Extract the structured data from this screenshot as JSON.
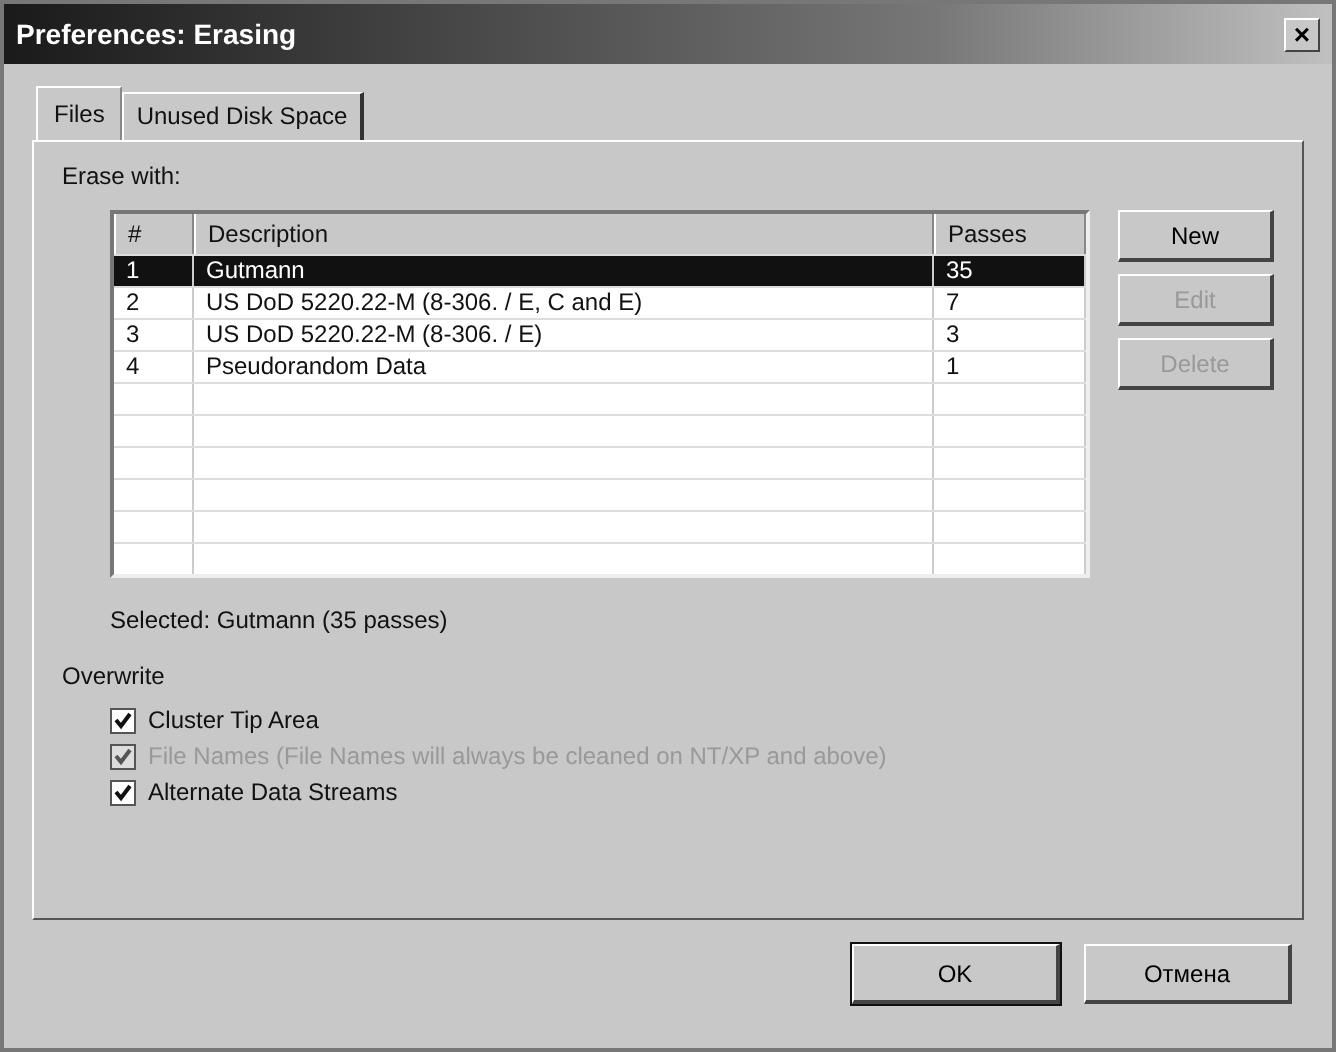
{
  "window": {
    "title": "Preferences: Erasing",
    "close": "×"
  },
  "tabs": [
    {
      "label": "Files",
      "selected": true
    },
    {
      "label": "Unused Disk Space",
      "selected": false
    }
  ],
  "erase_with": {
    "label": "Erase with:",
    "table": {
      "columns": [
        "#",
        "Description",
        "Passes"
      ],
      "rows": [
        {
          "cells": [
            "1",
            "Gutmann",
            "35"
          ],
          "selected": true
        },
        {
          "cells": [
            "2",
            "US DoD 5220.22-M (8-306. / E, C and E)",
            "7"
          ],
          "selected": false
        },
        {
          "cells": [
            "3",
            "US DoD 5220.22-M (8-306. / E)",
            "3"
          ],
          "selected": false
        },
        {
          "cells": [
            "4",
            "Pseudorandom Data",
            "1"
          ],
          "selected": false
        }
      ]
    },
    "buttons": [
      {
        "label": "New",
        "disabled": false
      },
      {
        "label": "Edit",
        "disabled": true
      },
      {
        "label": "Delete",
        "disabled": true
      }
    ],
    "selected_text": "Selected: Gutmann (35 passes)"
  },
  "overwrite": {
    "label": "Overwrite",
    "options": [
      {
        "label": "Cluster Tip Area",
        "checked": true,
        "disabled": false
      },
      {
        "label": "File Names (File Names will always be cleaned on NT/XP and above)",
        "checked": true,
        "disabled": true
      },
      {
        "label": "Alternate Data Streams",
        "checked": true,
        "disabled": false
      }
    ]
  },
  "buttons": [
    {
      "label": "OK",
      "default": true
    },
    {
      "label": "Отмена",
      "default": false
    }
  ]
}
